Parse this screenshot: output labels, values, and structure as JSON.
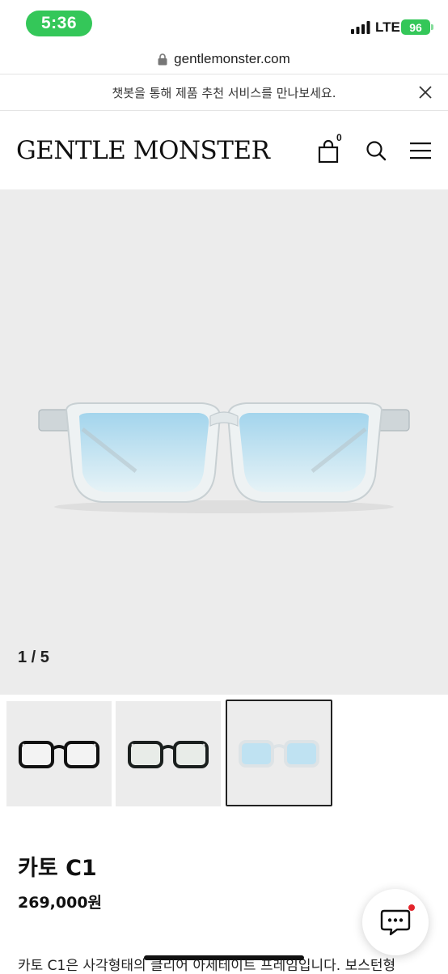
{
  "status_bar": {
    "time": "5:36",
    "network": "LTE",
    "battery": "96"
  },
  "browser": {
    "url": "gentlemonster.com"
  },
  "banner": {
    "text": "챗봇을 통해 제품 추천 서비스를 만나보세요."
  },
  "header": {
    "logo": "GENTLE MONSTER",
    "cart_count": "0"
  },
  "gallery": {
    "counter": "1 / 5",
    "thumbnails": [
      {
        "frame_color": "#111111",
        "lens_color": "#f3f3f3",
        "selected": false
      },
      {
        "frame_color": "#1a1f1e",
        "lens_color": "#e8ece8",
        "selected": false
      },
      {
        "frame_color": "#e4e8ea",
        "lens_color": "#bfe2f2",
        "selected": true
      }
    ]
  },
  "product": {
    "name": "카토 C1",
    "price": "269,000원",
    "description": "카토 C1은 사각형태의 클리어 아세테이트 프레임입니다. 보스턴형"
  },
  "colors": {
    "status_green": "#34c759",
    "hero_bg": "#ececec",
    "lens_blue": "#bfe2f2",
    "notification_red": "#e3242b"
  }
}
